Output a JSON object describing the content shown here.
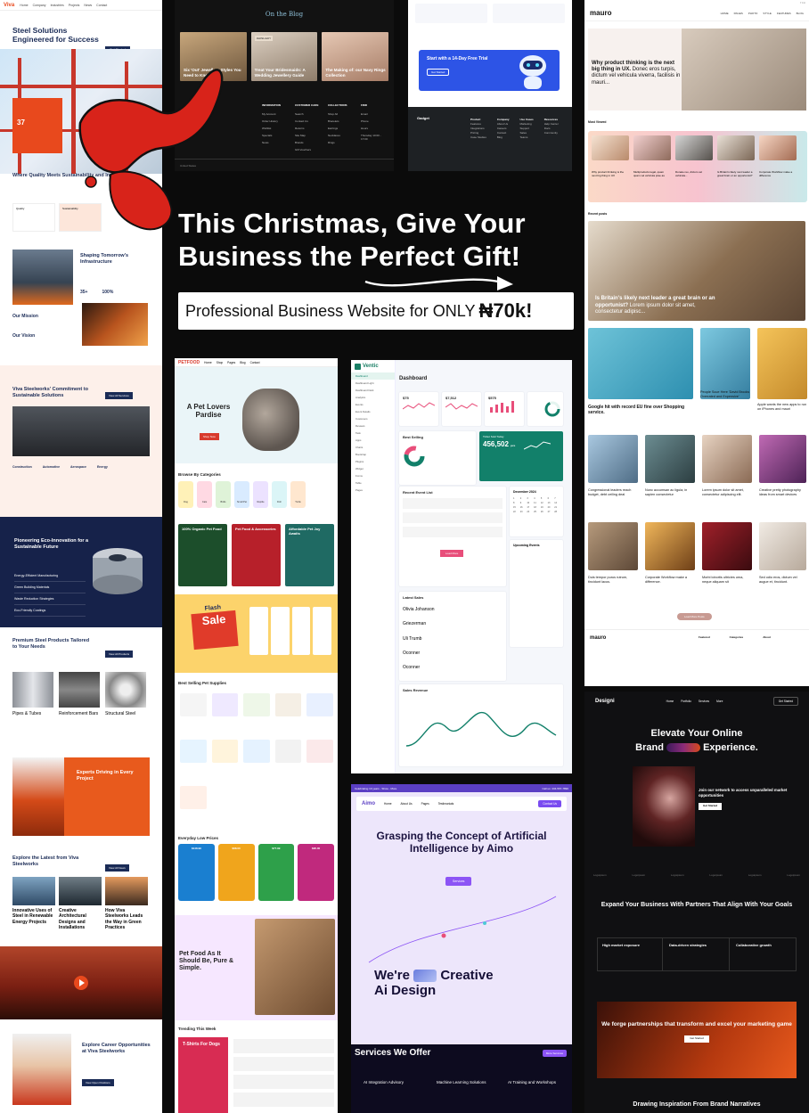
{
  "headline": {
    "line1": "This Christmas, Give Your",
    "line2": "Business the Perfect Gift!",
    "offer_prefix": "Professional Business Website for ONLY",
    "offer_price": "₦70k!"
  },
  "viva": {
    "logo": "Viva",
    "nav": [
      "Home",
      "Company",
      "Industries",
      "Projects",
      "News",
      "Contact"
    ],
    "hero_title": "Steel Solutions Engineered for Success",
    "hero_button": "Get Started",
    "stat_number": "37",
    "quality_title": "Where Quality Meets Sustainability and Innovation",
    "quality_cards": [
      "Quality",
      "Sustainability"
    ],
    "future_title": "Shaping Tomorrow's Infrastructure",
    "stat1": "35+",
    "stat2": "100%",
    "mission": "Our Mission",
    "vision": "Our Vision",
    "commit_title": "Viva Steelworks' Commitment to Sustainable Solutions",
    "commit_button": "View All Services",
    "sectors": [
      "Construction",
      "Automotive",
      "Aerospace",
      "Energy"
    ],
    "pioneer_title": "Pioneering Eco-Innovation for a Sustainable Future",
    "pioneer_list": [
      "Energy-Efficient Manufacturing",
      "Green Building Materials",
      "Waste Reduction Strategies",
      "Eco-Friendly Coatings"
    ],
    "products_title": "Premium Steel Products Tailored to Your Needs",
    "products_button": "View All Products",
    "products": [
      "Pipes & Tubes",
      "Reinforcement Bars",
      "Structural Steel"
    ],
    "experts_title": "Experts Driving in Every Project",
    "latest_title": "Explore the Latest from Viva Steelworks",
    "latest_button": "View All News",
    "news": [
      "Innovative Uses of Steel in Renewable Energy Projects",
      "Creative Architectural Designs and Installations",
      "How Viva Steelworks Leads the Way in Green Practices"
    ],
    "career_title": "Explore Career Opportunities at Viva Steelworks",
    "career_button": "View Open Positions"
  },
  "blog": {
    "title": "On the Blog",
    "cards": [
      {
        "caption": "Six 'Out' Jewellery Styles You Need to Know"
      },
      {
        "tag": "JEWELLERY",
        "caption": "Treat Your Bridesmaids: A Wedding Jewellery Guide"
      },
      {
        "caption": "The Making of: our Navy Rings Collection"
      }
    ],
    "footer_cols": [
      {
        "h": "INFORMATION",
        "items": [
          "My Account",
          "Order History",
          "Wishlist",
          "Specials",
          "News"
        ]
      },
      {
        "h": "CUSTOMER CARE",
        "items": [
          "Search",
          "Contact Us",
          "Returns",
          "Site Map",
          "Brands",
          "Gift Vouchers"
        ]
      },
      {
        "h": "COLLECTIONS",
        "items": [
          "Shop All",
          "Bracelets",
          "Earrings",
          "Necklaces",
          "Rings"
        ]
      },
      {
        "h": "FIND",
        "items": [
          "Email",
          "Phone",
          "Hours",
          "Thursday 10:00 - 17:00"
        ]
      }
    ],
    "country": "United States"
  },
  "gadget": {
    "trial_title": "Start with a 14-Day Free Trial",
    "trial_button": "Get Started",
    "brand": "Gadget",
    "footer_cols": [
      {
        "h": "Product",
        "items": [
          "Features",
          "Integrations",
          "Pricing",
          "Case Studies"
        ]
      },
      {
        "h": "Company",
        "items": [
          "About Us",
          "Careers",
          "Contact",
          "Blog"
        ]
      },
      {
        "h": "Use Cases",
        "items": [
          "Marketing",
          "Support",
          "Sales",
          "Teams"
        ]
      },
      {
        "h": "Resources",
        "items": [
          "Help Center",
          "Docs",
          "Community"
        ]
      }
    ]
  },
  "mauro": {
    "logo": "mauro",
    "nav": [
      "HOME",
      "PAGES",
      "PHOTO",
      "STYLE",
      "FEATURES",
      "BLOG"
    ],
    "feature_bold": "Why product thinking is the next big thing in UX.",
    "feature_rest": "Donec eros turpis, dictum vel vehicula viverra, facilisis in mauri...",
    "most_viewed": "Most Viewed",
    "mv_items": [
      "Why product thinking is the next big thing in UX",
      "Multiproducts legal, quam quam vel vehicula prae as",
      "Donate reo, dictum vel vehicula...",
      "Is Britain's likely next leader a great brain or an opportunist?",
      "Corporate Workflow make a difference"
    ],
    "recent_posts": "Recent posts",
    "big_caption": "Is Britain's likely next leader a great brain or an opportunist?",
    "big_rest": "Lorem ipsum dolor sit amet, consectetur adipisc...",
    "grid_captions": [
      "Google hit with record EU fine over Shopping service.",
      "People Scue Here 'David Brooks Overrated and Expensive'",
      "Apple wants the new apps to run on iPhones and mauri",
      "Congressional leaders reach budget, debt ceiling deal",
      "Nunc accumsan ac ligula, in sapien consectetur",
      "Lorem ipsum dolor sit amet, consectetur adipiscing elit.",
      "Creative pretty photography ideas from smart devices",
      "Duis tempor purus rutrum, tincidunt lacus.",
      "Corporate Workflow make a difference.",
      "Morbi lobortis ultricies urna, neque aliquam sit",
      "Sed odio eros, dictum vel augue et, tincidunt."
    ],
    "more_button": "Load More Posts",
    "footer_cols": [
      "Featured",
      "Categories",
      "About"
    ]
  },
  "pet": {
    "brand": "PETFOOD",
    "nav": [
      "Home",
      "Shop",
      "Pages",
      "Blog",
      "Contact"
    ],
    "hero_title": "A Pet Lovers Pardise",
    "hero_button": "Shop Now",
    "categories_title": "Browse By Categories",
    "categories": [
      "Dog",
      "Cats",
      "Birds",
      "Small Pet",
      "Reptile",
      "Fish",
      "Turtle"
    ],
    "promos": [
      "100% Organic Pet Food",
      "Pet Food & Accessories",
      "Affordable Pet Joy Awaits"
    ],
    "flash_word": "Flash",
    "sale_word": "Sale",
    "best_title": "Best Selling Pet Supplies",
    "everyday_title": "Everyday Low Prices",
    "everyday_prices": [
      "$148.99",
      "$68.00",
      "$77.99",
      "$95.00"
    ],
    "petfood_title": "Pet Food As It Should Be, Pure & Simple.",
    "trending_title": "Trending This Week",
    "trend_box": "T-Shirts For Dogs"
  },
  "ventic": {
    "brand": "Ventic",
    "page": "Dashboard",
    "menu": [
      "Dashboard",
      "Dashboard Light",
      "Dashboard Dark",
      "Analytics",
      "Events",
      "Event Details",
      "Customers",
      "Reviews",
      "Task",
      "Apps",
      "Charts",
      "Bootstrap",
      "Plugins",
      "Widget",
      "Forms",
      "Table",
      "Pages"
    ],
    "kpis": [
      "$75",
      "$7,512",
      "$575"
    ],
    "best_selling": "Best Selling",
    "ticket_sold": "Ticket Sold Today",
    "ticket_value": "456,502",
    "ticket_unit": "pcs",
    "recent_event": "Recent Event List",
    "calendar": "December 2024",
    "latest_sales": "Latest Sales",
    "upcoming": "Upcoming Events",
    "sales_revenue": "Sales Revenue",
    "load_more": "Load More",
    "names": [
      "Olivia Johanson",
      "Griezerman",
      "Uli Trumb",
      "Oconner",
      "Oconner"
    ]
  },
  "aimo": {
    "top_left": "Celebrating 10 years - Show - More",
    "top_right": "Call us: 434-567-7890",
    "logo": "Aimo",
    "nav": [
      "Home",
      "About Us",
      "Pages",
      "Testimonials"
    ],
    "cta": "Contact Us",
    "headline": "Grasping the Concept of Artificial Intelligence by Aimo",
    "services_button": "Services",
    "we_are": "We're",
    "creative": "Creative",
    "ai_design": "Ai Design",
    "services_title": "Services We Offer",
    "more_services": "More Services",
    "service_items": [
      "AI Integration Advisory",
      "Machine Learning Solutions",
      "AI Training and Workshops"
    ]
  },
  "designi": {
    "logo": "Designi",
    "nav": [
      "Home",
      "Portfolio",
      "Services",
      "More"
    ],
    "nav_button": "Get Started",
    "h1_line1": "Elevate Your Online",
    "h1_brand": "Brand",
    "h1_exp": "Experience.",
    "join_title": "Join our network to access unparalleled market opportunities",
    "join_button": "Get Started",
    "logos": [
      "Logoipsum",
      "Logoipsum",
      "Logoipsum",
      "Logoipsum",
      "Logoipsum",
      "Logoipsum"
    ],
    "partner_title": "Expand Your Business With Partners That Align With Your Goals",
    "features": [
      "High market exposure",
      "Data-driven strategies",
      "Collaborative growth"
    ],
    "forge_title": "We forge partnerships that transform and excel your marketing game",
    "forge_button": "Get Started",
    "bottom_title": "Drawing Inspiration From Brand Narratives"
  }
}
